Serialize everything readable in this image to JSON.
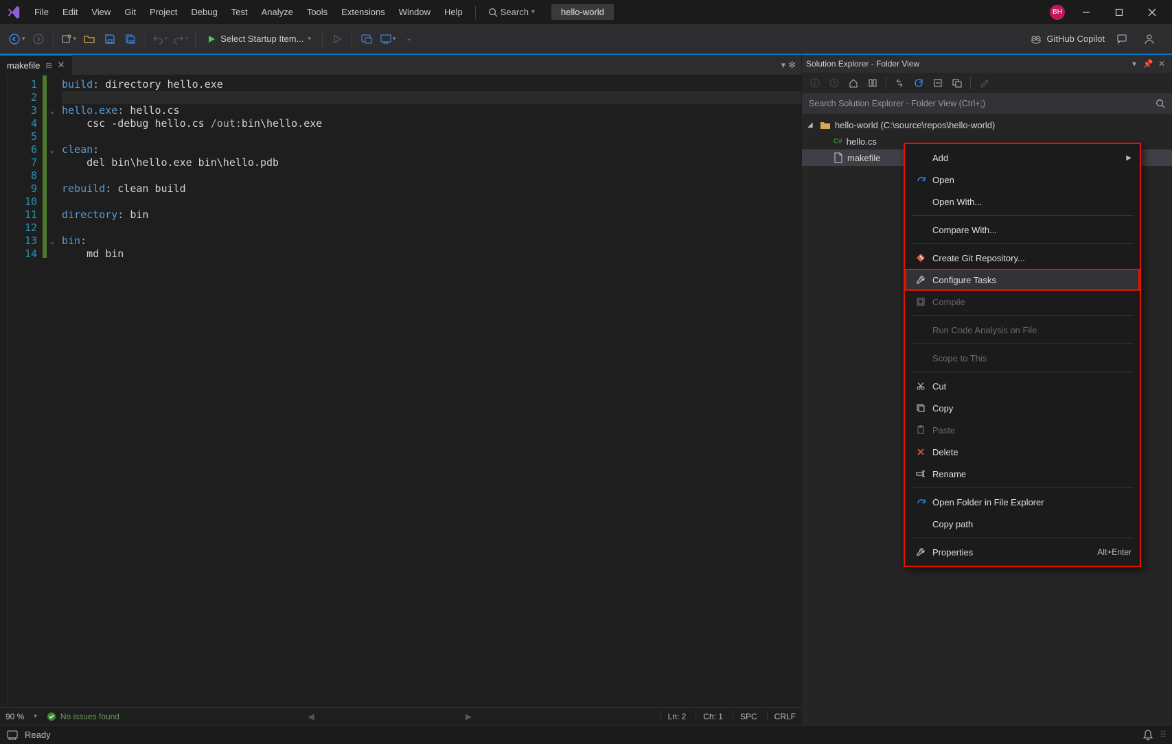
{
  "menu": [
    "File",
    "Edit",
    "View",
    "Git",
    "Project",
    "Debug",
    "Test",
    "Analyze",
    "Tools",
    "Extensions",
    "Window",
    "Help"
  ],
  "search_label": "Search",
  "project_pill": "hello-world",
  "avatar_initials": "BH",
  "toolbar": {
    "start_label": "Select Startup Item..."
  },
  "copilot_label": "GitHub Copilot",
  "doc_tab": {
    "name": "makefile"
  },
  "editor": {
    "lines": [
      {
        "n": 1,
        "raw": [
          [
            "kw",
            "build"
          ],
          [
            "op",
            ":"
          ],
          [
            "txt",
            " directory hello.exe"
          ]
        ]
      },
      {
        "n": 2,
        "raw": []
      },
      {
        "n": 3,
        "fold": "v",
        "raw": [
          [
            "kw",
            "hello.exe"
          ],
          [
            "op",
            ":"
          ],
          [
            "txt",
            " hello.cs"
          ]
        ]
      },
      {
        "n": 4,
        "raw": [
          [
            "txt",
            "    csc -debug hello.cs "
          ],
          [
            "op",
            "/out:"
          ],
          [
            "txt",
            "bin\\hello.exe"
          ]
        ]
      },
      {
        "n": 5,
        "raw": []
      },
      {
        "n": 6,
        "fold": "v",
        "raw": [
          [
            "kw",
            "clean"
          ],
          [
            "op",
            ":"
          ]
        ]
      },
      {
        "n": 7,
        "raw": [
          [
            "txt",
            "    del bin\\hello.exe bin\\hello.pdb"
          ]
        ]
      },
      {
        "n": 8,
        "raw": []
      },
      {
        "n": 9,
        "raw": [
          [
            "kw",
            "rebuild"
          ],
          [
            "op",
            ":"
          ],
          [
            "txt",
            " clean build"
          ]
        ]
      },
      {
        "n": 10,
        "raw": []
      },
      {
        "n": 11,
        "raw": [
          [
            "kw",
            "directory"
          ],
          [
            "op",
            ":"
          ],
          [
            "txt",
            " bin"
          ]
        ]
      },
      {
        "n": 12,
        "raw": []
      },
      {
        "n": 13,
        "fold": "v",
        "raw": [
          [
            "kw",
            "bin"
          ],
          [
            "op",
            ":"
          ]
        ]
      },
      {
        "n": 14,
        "raw": [
          [
            "txt",
            "    md bin"
          ]
        ]
      }
    ],
    "current_line": 2
  },
  "editor_status": {
    "zoom": "90 %",
    "issues": "No issues found",
    "ln": "Ln: 2",
    "ch": "Ch: 1",
    "ws": "SPC",
    "eol": "CRLF"
  },
  "panel": {
    "title": "Solution Explorer - Folder View",
    "search_placeholder": "Search Solution Explorer - Folder View (Ctrl+;)",
    "root": "hello-world (C:\\source\\repos\\hello-world)",
    "files": [
      "hello.cs",
      "makefile"
    ],
    "selected": "makefile"
  },
  "context_menu": [
    {
      "label": "Add",
      "arrow": true
    },
    {
      "label": "Open",
      "icon": "redo"
    },
    {
      "label": "Open With..."
    },
    {
      "sep": true
    },
    {
      "label": "Compare With..."
    },
    {
      "sep": true
    },
    {
      "label": "Create Git Repository...",
      "icon": "git"
    },
    {
      "label": "Configure Tasks",
      "icon": "wrench",
      "highlight": true
    },
    {
      "label": "Compile",
      "icon": "compile",
      "disabled": true
    },
    {
      "sep": true
    },
    {
      "label": "Run Code Analysis on File",
      "disabled": true
    },
    {
      "sep": true
    },
    {
      "label": "Scope to This",
      "disabled": true
    },
    {
      "sep": true
    },
    {
      "label": "Cut",
      "icon": "cut"
    },
    {
      "label": "Copy",
      "icon": "copy"
    },
    {
      "label": "Paste",
      "icon": "paste",
      "disabled": true
    },
    {
      "label": "Delete",
      "icon": "delete"
    },
    {
      "label": "Rename",
      "icon": "rename"
    },
    {
      "sep": true
    },
    {
      "label": "Open Folder in File Explorer",
      "icon": "redo"
    },
    {
      "label": "Copy path"
    },
    {
      "sep": true
    },
    {
      "label": "Properties",
      "icon": "wrench",
      "shortcut": "Alt+Enter"
    }
  ],
  "status": {
    "text": "Ready"
  }
}
